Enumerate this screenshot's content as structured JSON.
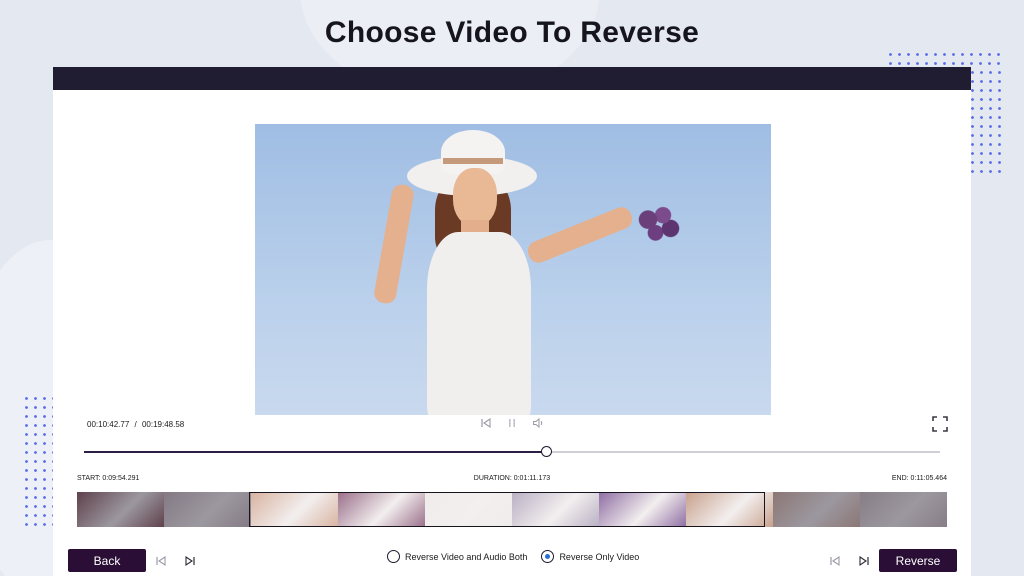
{
  "page": {
    "title": "Choose Video To Reverse"
  },
  "player": {
    "current_time": "00:10:42.77",
    "separator": "/",
    "total_time": "00:19:48.58",
    "progress_fraction": 0.54
  },
  "trim": {
    "start_label": "START: 0:09:54.291",
    "duration_label": "DURATION: 0:01:11.173",
    "end_label": "END: 0:11:05.464"
  },
  "filmstrip": {
    "frames": [
      {
        "tone": "#8a5a5e",
        "dim": true
      },
      {
        "tone": "#c9bcc0",
        "dim": true
      },
      {
        "tone": "#d8b3a0",
        "dim": false
      },
      {
        "tone": "#9a6f8a",
        "dim": false
      },
      {
        "tone": "#f0ecec",
        "dim": false
      },
      {
        "tone": "#b9b0c4",
        "dim": false
      },
      {
        "tone": "#8f6ea3",
        "dim": false
      },
      {
        "tone": "#c8a18c",
        "dim": false
      },
      {
        "tone": "#d7b8a6",
        "dim": true
      },
      {
        "tone": "#cfc2c4",
        "dim": true
      }
    ]
  },
  "options": {
    "both_label": "Reverse Video and Audio Both",
    "video_only_label": "Reverse Only Video",
    "selected": "video_only"
  },
  "buttons": {
    "back_label": "Back",
    "reverse_label": "Reverse"
  },
  "colors": {
    "titlebar": "#201d33",
    "button": "#2a0e36",
    "radio_accent": "#2b6fd6",
    "background": "#e3e8f1"
  }
}
